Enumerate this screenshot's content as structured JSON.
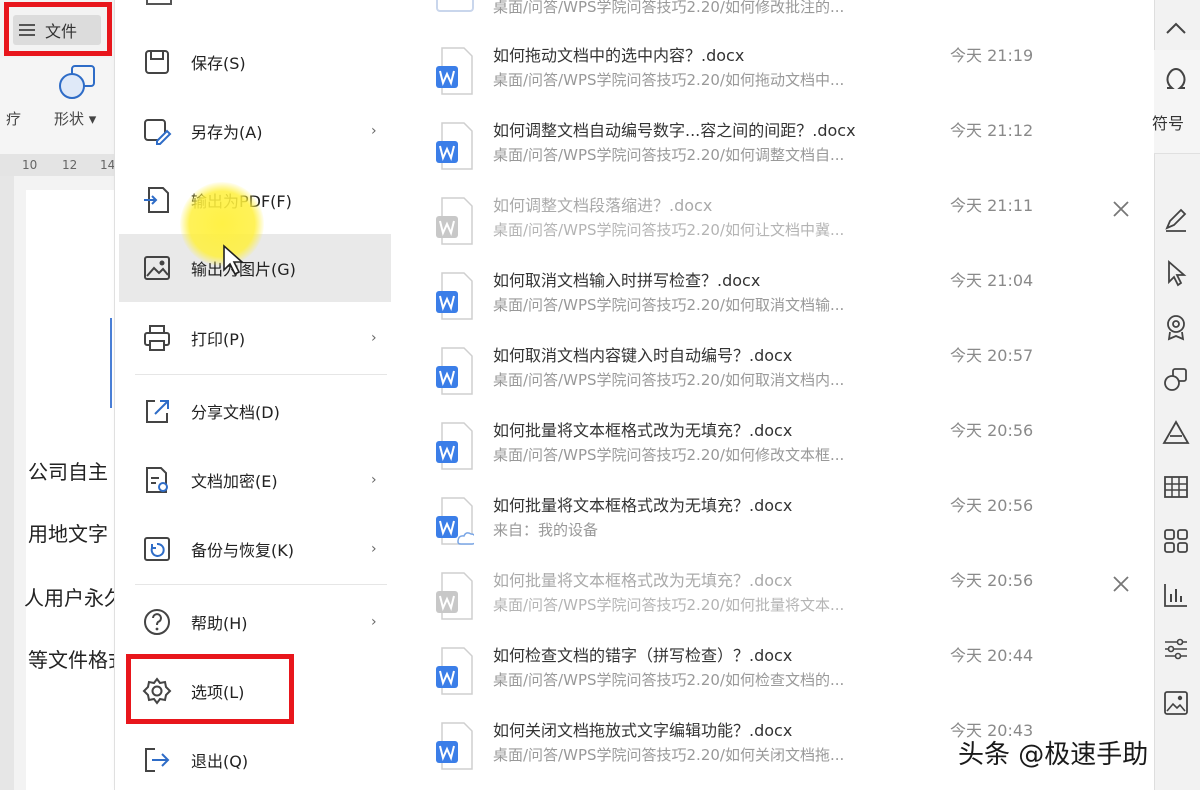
{
  "toolbar": {
    "file_label": "文件",
    "shape_label": "形状",
    "left_stub_label": "疗"
  },
  "ruler": {
    "ticks": [
      "10",
      "12",
      "14"
    ]
  },
  "document": {
    "lines": [
      "公司自主",
      "用地文字",
      "人用户永久",
      "等文件格式"
    ]
  },
  "file_menu": {
    "items": [
      {
        "label": "保存(S)",
        "icon": "save-icon",
        "arrow": ""
      },
      {
        "label": "另存为(A)",
        "icon": "save-as-icon",
        "arrow": "›"
      },
      {
        "label": "输出为PDF(F)",
        "icon": "export-pdf-icon",
        "arrow": ""
      },
      {
        "label": "输出为图片(G)",
        "icon": "export-image-icon",
        "arrow": ""
      },
      {
        "label": "打印(P)",
        "icon": "print-icon",
        "arrow": "›"
      },
      {
        "label": "分享文档(D)",
        "icon": "share-icon",
        "arrow": ""
      },
      {
        "label": "文档加密(E)",
        "icon": "encrypt-icon",
        "arrow": "›"
      },
      {
        "label": "备份与恢复(K)",
        "icon": "backup-icon",
        "arrow": "›"
      },
      {
        "label": "帮助(H)",
        "icon": "help-icon",
        "arrow": "›"
      },
      {
        "label": "选项(L)",
        "icon": "gear-icon",
        "arrow": ""
      },
      {
        "label": "退出(Q)",
        "icon": "exit-icon",
        "arrow": ""
      }
    ]
  },
  "recent_files": [
    {
      "name": "如何拖动文档中的选中内容？.docx",
      "path": "桌面/问答/WPS学院问答技巧2.20/如何拖动文档中...",
      "time": "今天 21:19",
      "dim": false,
      "cloud": false,
      "removable": false
    },
    {
      "name": "如何调整文档自动编号数字...容之间的间距？.docx",
      "path": "桌面/问答/WPS学院问答技巧2.20/如何调整文档自...",
      "time": "今天 21:12",
      "dim": false,
      "cloud": false,
      "removable": false
    },
    {
      "name": "如何调整文档段落缩进？.docx",
      "path": "桌面/问答/WPS学院问答技巧2.20/如何让文档中冀...",
      "time": "今天 21:11",
      "dim": true,
      "cloud": false,
      "removable": true
    },
    {
      "name": "如何取消文档输入时拼写检查？.docx",
      "path": "桌面/问答/WPS学院问答技巧2.20/如何取消文档输...",
      "time": "今天 21:04",
      "dim": false,
      "cloud": false,
      "removable": false
    },
    {
      "name": "如何取消文档内容键入时自动编号？.docx",
      "path": "桌面/问答/WPS学院问答技巧2.20/如何取消文档内...",
      "time": "今天 20:57",
      "dim": false,
      "cloud": false,
      "removable": false
    },
    {
      "name": "如何批量将文本框格式改为无填充？.docx",
      "path": "桌面/问答/WPS学院问答技巧2.20/如何修改文本框...",
      "time": "今天 20:56",
      "dim": false,
      "cloud": false,
      "removable": false
    },
    {
      "name": "如何批量将文本框格式改为无填充？.docx",
      "path": "来自：我的设备",
      "time": "今天 20:56",
      "dim": false,
      "cloud": true,
      "removable": false
    },
    {
      "name": "如何批量将文本框格式改为无填充？.docx",
      "path": "桌面/问答/WPS学院问答技巧2.20/如何批量将文本...",
      "time": "今天 20:56",
      "dim": true,
      "cloud": false,
      "removable": true
    },
    {
      "name": "如何检查文档的错字（拼写检查）？.docx",
      "path": "桌面/问答/WPS学院问答技巧2.20/如何检查文档的...",
      "time": "今天 20:44",
      "dim": false,
      "cloud": false,
      "removable": false
    },
    {
      "name": "如何关闭文档拖放式文字编辑功能？.docx",
      "path": "桌面/问答/WPS学院问答技巧2.20/如何关闭文档拖...",
      "time": "今天 20:43",
      "dim": false,
      "cloud": false,
      "removable": false
    }
  ],
  "top_partial_path": "桌面/问答/WPS学院问答技巧2.20/如何修改批注的...",
  "right_panel": {
    "symbol_label": "符号",
    "icons": [
      "chevron-up-icon",
      "omega-icon",
      "pen-icon",
      "select-pointer-icon",
      "location-icon",
      "shapes-icon",
      "triangle-icon",
      "table-icon",
      "apps-icon",
      "chart-icon",
      "settings-sliders-icon",
      "image-icon"
    ]
  },
  "colors": {
    "highlight_red": "#e8161c",
    "word_blue": "#3b7ee8",
    "click_yellow": "#fff03c"
  },
  "watermark": "头条 @极速手助"
}
